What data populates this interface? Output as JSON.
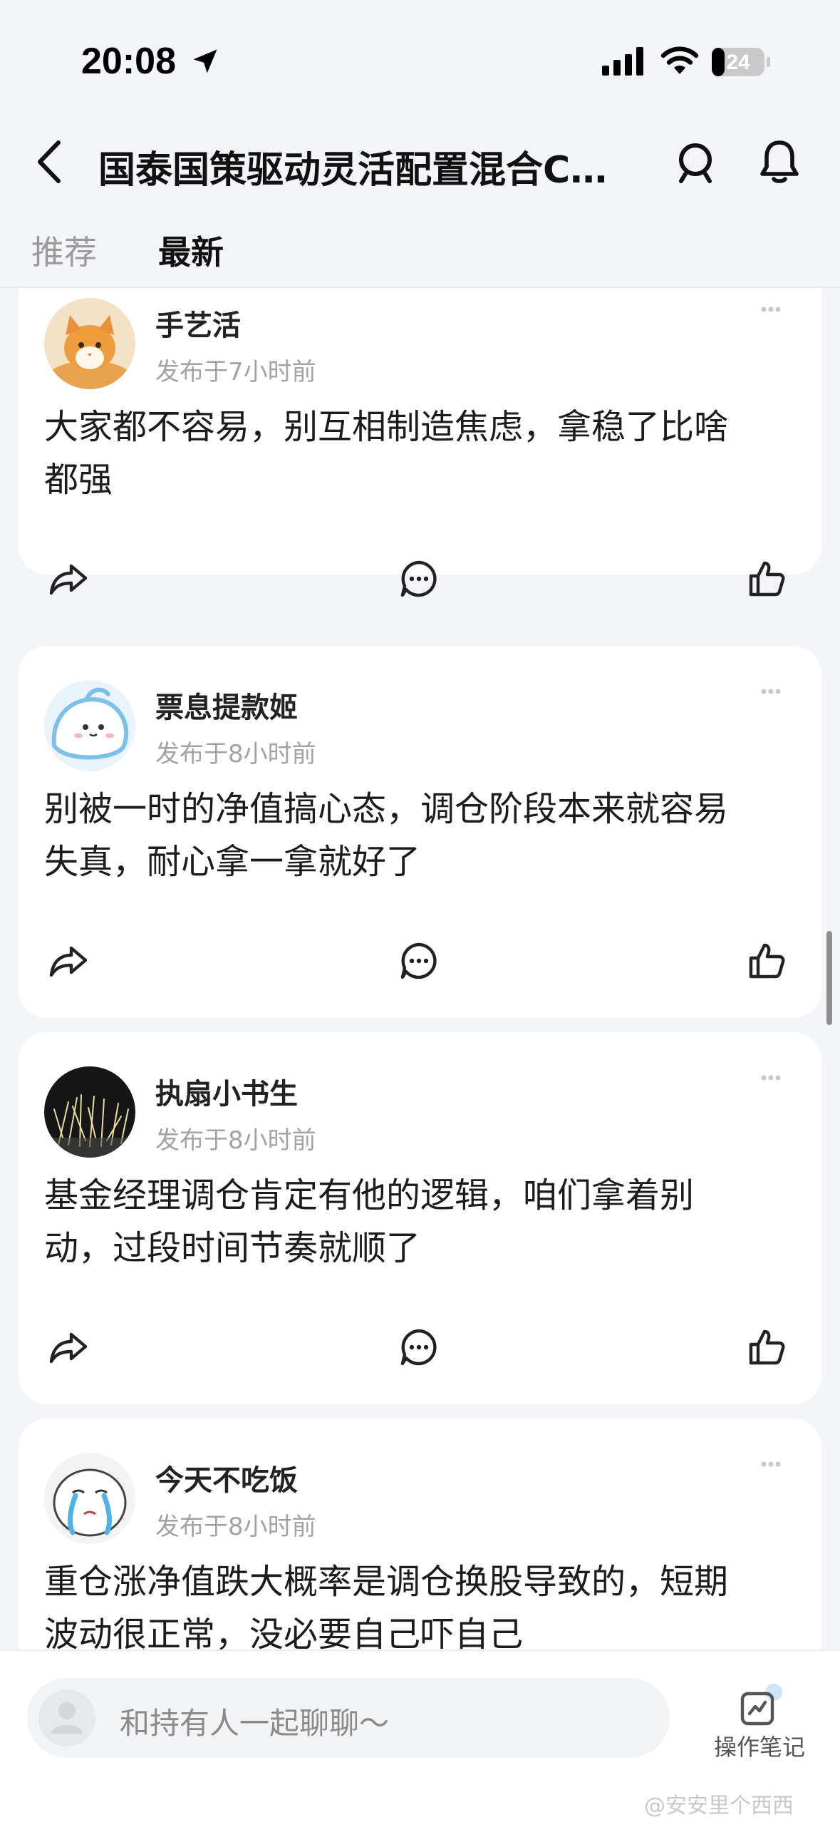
{
  "status_bar": {
    "time": "20:08",
    "battery": "24"
  },
  "header": {
    "title": "国泰国策驱动灵活配置混合C…"
  },
  "tabs": [
    {
      "label": "推荐",
      "active": false
    },
    {
      "label": "最新",
      "active": true
    }
  ],
  "posts": [
    {
      "author": "手艺活",
      "time": "发布于7小时前",
      "content_line1": "大家都不容易，别互相制造焦虑，拿稳了比啥",
      "content_line2": "都强"
    },
    {
      "author": "票息提款姬",
      "time": "发布于8小时前",
      "content_line1": "别被一时的净值搞心态，调仓阶段本来就容易",
      "content_line2": "失真，耐心拿一拿就好了"
    },
    {
      "author": "执扇小书生",
      "time": "发布于8小时前",
      "content_line1": "基金经理调仓肯定有他的逻辑，咱们拿着别",
      "content_line2": "动，过段时间节奏就顺了"
    },
    {
      "author": "今天不吃饭",
      "time": "发布于8小时前",
      "content_line1": "重仓涨净值跌大概率是调仓换股导致的，短期",
      "content_line2": "波动很正常，没必要自己吓自己"
    }
  ],
  "bottom_bar": {
    "chat_placeholder": "和持有人一起聊聊～",
    "note_label": "操作笔记",
    "watermark": "@安安里个西西"
  },
  "colors": {
    "background": "#f4f5f8",
    "card": "#ffffff",
    "muted_text": "#a3a3a3",
    "note_dot": "#cfe3fb"
  },
  "icons": [
    "location-arrow-icon",
    "signal-icon",
    "wifi-icon",
    "battery-icon",
    "back-icon",
    "search-icon",
    "bell-icon",
    "more-icon",
    "share-icon",
    "comment-icon",
    "like-icon",
    "note-icon"
  ]
}
